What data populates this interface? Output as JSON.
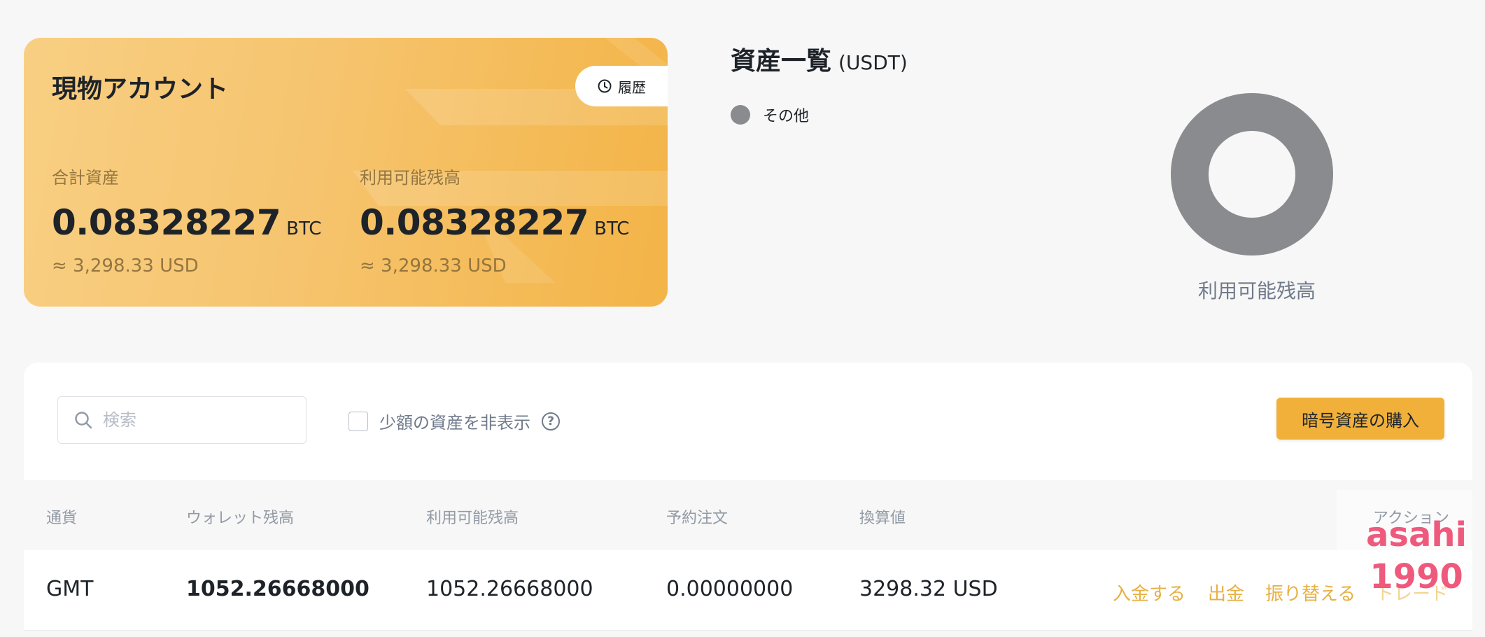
{
  "spot_card": {
    "title": "現物アカウント",
    "history_label": "履歴",
    "total": {
      "label": "合計資産",
      "amount": "0.08328227",
      "unit": "BTC",
      "usd": "≈ 3,298.33 USD"
    },
    "available": {
      "label": "利用可能残高",
      "amount": "0.08328227",
      "unit": "BTC",
      "usd": "≈ 3,298.33 USD"
    }
  },
  "overview": {
    "title": "資産一覧",
    "unit": "(USDT)",
    "legend": [
      {
        "label": "その他",
        "color": "#8a8b8e"
      }
    ],
    "donut_label": "利用可能残高"
  },
  "toolbar": {
    "search_placeholder": "検索",
    "hide_small_label": "少額の資産を非表示",
    "help_glyph": "?",
    "buy_label": "暗号資産の購入"
  },
  "table": {
    "headers": [
      "通貨",
      "ウォレット残高",
      "利用可能残高",
      "予約注文",
      "換算値",
      "アクション"
    ],
    "rows": [
      {
        "currency": "GMT",
        "wallet_balance": "1052.26668000",
        "available": "1052.26668000",
        "in_order": "0.00000000",
        "value": "3298.32 USD",
        "actions": [
          "入金する",
          "出金",
          "振り替える",
          "トレード"
        ]
      }
    ]
  },
  "watermark": {
    "line1": "asahi",
    "line2": "1990"
  },
  "colors": {
    "accent": "#f0b03a",
    "action_text": "#e7b044",
    "donut": "#8a8b8e",
    "watermark": "#ee5a7c"
  }
}
